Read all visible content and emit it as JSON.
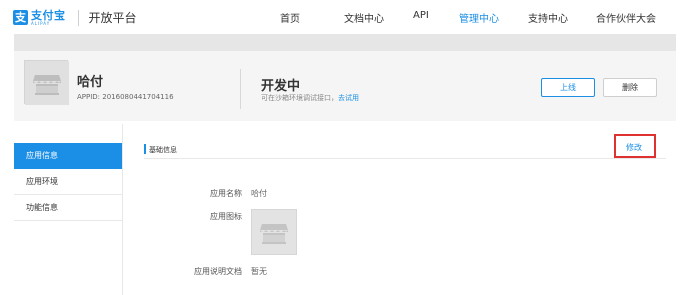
{
  "brand": {
    "logo_glyph": "支",
    "logo_cn": "支付宝",
    "logo_en": "ALIPAY",
    "platform": "开放平台",
    "accent": "#1b8fe6"
  },
  "nav": {
    "items": [
      "首页",
      "文档中心",
      "API",
      "管理中心",
      "支持中心",
      "合作伙伴大会"
    ],
    "active": "管理中心"
  },
  "app": {
    "name": "哈付",
    "appid": "APPID: 2016080441704116",
    "status": "开发中",
    "status_desc": "可在沙箱环境调试接口，",
    "status_link": "去试用",
    "online_label": "上线",
    "delete_label": "删除"
  },
  "sidebar": {
    "items": [
      {
        "label": "应用信息",
        "active": true
      },
      {
        "label": "应用环境"
      },
      {
        "label": "功能信息"
      }
    ]
  },
  "section": {
    "title": "基础信息",
    "edit_label": "修改"
  },
  "fields": {
    "name_label": "应用名称",
    "name_value": "哈付",
    "icon_label": "应用图标",
    "doc_label": "应用说明文档",
    "doc_value": "暂无"
  },
  "highlight_color": "#e03131"
}
